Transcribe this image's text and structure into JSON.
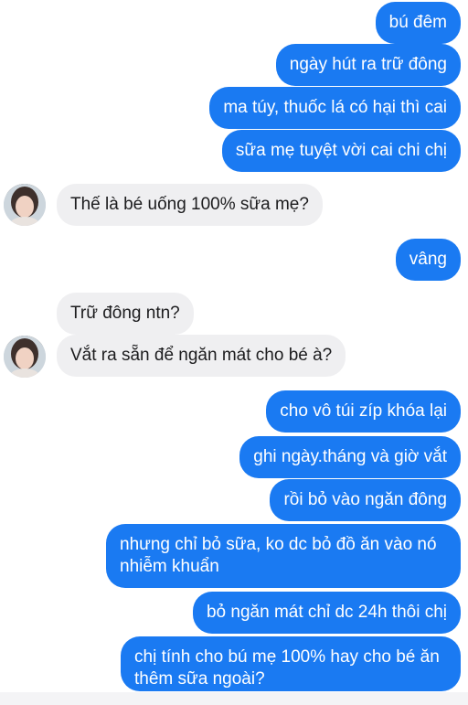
{
  "messages": [
    {
      "from": "me",
      "text": "bú đêm"
    },
    {
      "from": "me",
      "text": "ngày hút ra trữ đông"
    },
    {
      "from": "me",
      "text": "ma túy, thuốc lá có hại thì cai"
    },
    {
      "from": "me",
      "text": "sữa mẹ tuyệt vời cai chi chị"
    },
    {
      "from": "them",
      "text": "Thế là bé uống 100% sữa mẹ?"
    },
    {
      "from": "me",
      "text": "vâng"
    },
    {
      "from": "them",
      "text": "Trữ đông ntn?"
    },
    {
      "from": "them",
      "text": "Vắt ra sẵn để ngăn mát cho bé à?"
    },
    {
      "from": "me",
      "text": "cho vô túi zíp khóa lại"
    },
    {
      "from": "me",
      "text": "ghi ngày.tháng và giờ vắt"
    },
    {
      "from": "me",
      "text": "rồi bỏ vào ngăn đông"
    },
    {
      "from": "me",
      "text": "nhưng chỉ bỏ sữa, ko dc bỏ đồ ăn vào nó nhiễm khuẩn"
    },
    {
      "from": "me",
      "text": "bỏ ngăn mát chỉ dc 24h thôi chị"
    },
    {
      "from": "me",
      "text": "chị tính cho bú mẹ 100% hay cho bé ăn thêm sữa ngoài?"
    }
  ],
  "colors": {
    "outgoing_bubble": "#1a7af2",
    "incoming_bubble": "#efeff1"
  }
}
